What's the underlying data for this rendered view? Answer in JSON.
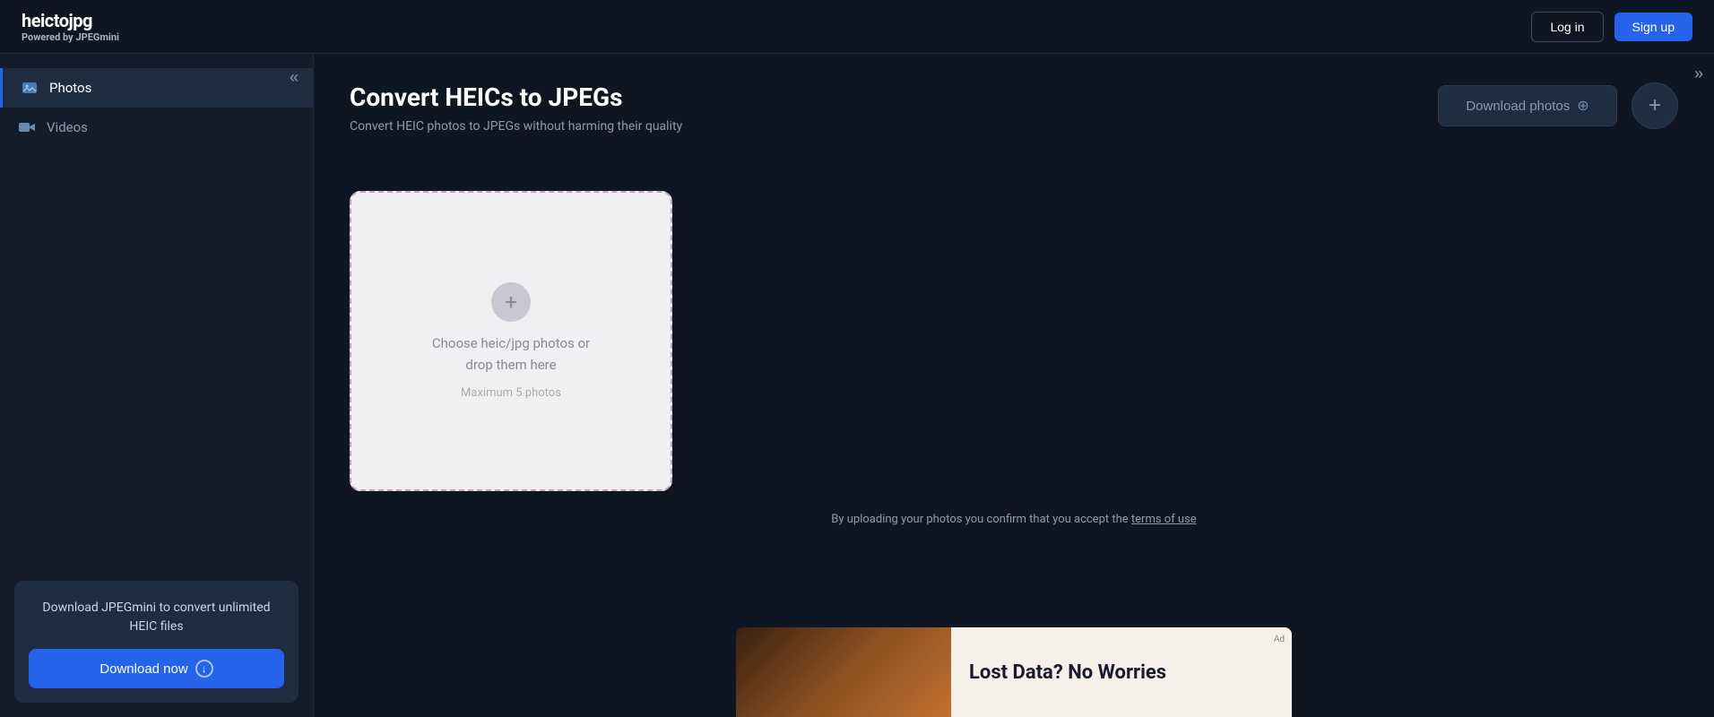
{
  "header": {
    "logo_title": "heictojpg",
    "logo_subtitle_prefix": "Powered by ",
    "logo_subtitle_brand": "JPEGmini",
    "login_label": "Log in",
    "signup_label": "Sign up"
  },
  "sidebar": {
    "collapse_icon": "«",
    "items": [
      {
        "id": "photos",
        "label": "Photos",
        "active": true
      },
      {
        "id": "videos",
        "label": "Videos",
        "active": false
      }
    ],
    "promo": {
      "text": "Download JPEGmini to convert unlimited HEIC files",
      "button_label": "Download now"
    }
  },
  "content": {
    "page_title": "Convert HEICs to JPEGs",
    "page_subtitle": "Convert HEIC photos to JPEGs without harming their quality",
    "download_photos_label": "Download photos",
    "add_button_icon": "+",
    "dropzone": {
      "plus_icon": "+",
      "text_line1": "Choose heic/jpg photos or",
      "text_line2": "drop them here",
      "max_text": "Maximum 5 photos"
    },
    "terms_text": "By uploading your photos you confirm that you accept the ",
    "terms_link": "terms of use"
  },
  "ad": {
    "headline": "Lost Data? No Worries",
    "badge": "Ad"
  },
  "colors": {
    "bg_dark": "#0f1623",
    "sidebar_bg": "#131c2a",
    "accent_blue": "#2563eb",
    "text_muted": "#8a9bb0"
  }
}
